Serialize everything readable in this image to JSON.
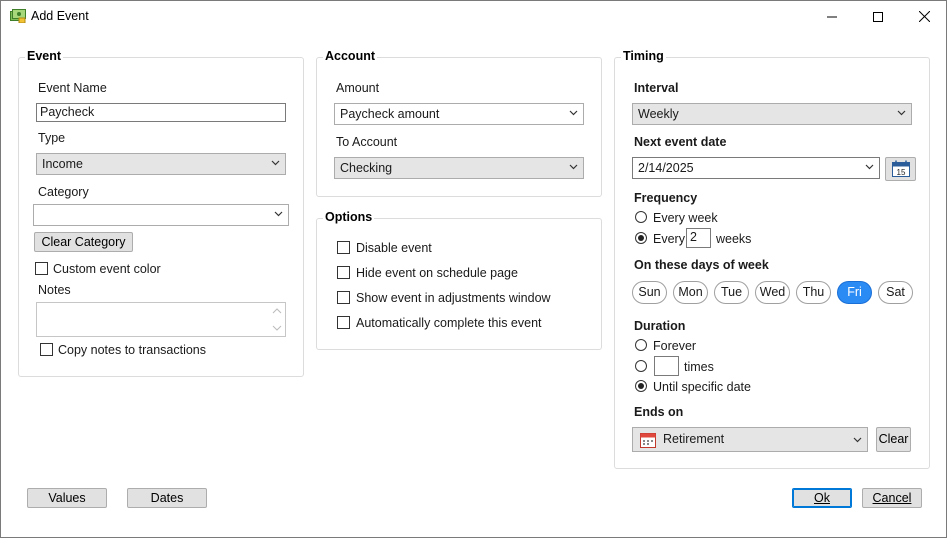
{
  "window": {
    "title": "Add Event"
  },
  "event": {
    "group_title": "Event",
    "name_label": "Event Name",
    "name_value": "Paycheck",
    "type_label": "Type",
    "type_value": "Income",
    "category_label": "Category",
    "category_value": "",
    "clear_category_label": "Clear Category",
    "custom_color_label": "Custom event color",
    "notes_label": "Notes",
    "notes_value": "",
    "copy_notes_label": "Copy notes to transactions"
  },
  "account": {
    "group_title": "Account",
    "amount_label": "Amount",
    "amount_value": "Paycheck amount",
    "to_account_label": "To Account",
    "to_account_value": "Checking"
  },
  "options": {
    "group_title": "Options",
    "items": [
      {
        "label": "Disable event",
        "checked": false
      },
      {
        "label": "Hide event on schedule page",
        "checked": false
      },
      {
        "label": "Show event in adjustments window",
        "checked": false
      },
      {
        "label": "Automatically complete this event",
        "checked": false
      }
    ]
  },
  "timing": {
    "group_title": "Timing",
    "interval_label": "Interval",
    "interval_value": "Weekly",
    "next_date_label": "Next event date",
    "next_date_value": "2/14/2025",
    "calendar_day": "15",
    "frequency_label": "Frequency",
    "every_week_label": "Every week",
    "every_label": "Every",
    "every_n_value": "2",
    "weeks_label": "weeks",
    "days_label": "On these days of week",
    "days": [
      {
        "label": "Sun",
        "selected": false
      },
      {
        "label": "Mon",
        "selected": false
      },
      {
        "label": "Tue",
        "selected": false
      },
      {
        "label": "Wed",
        "selected": false
      },
      {
        "label": "Thu",
        "selected": false
      },
      {
        "label": "Fri",
        "selected": true
      },
      {
        "label": "Sat",
        "selected": false
      }
    ],
    "duration_label": "Duration",
    "forever_label": "Forever",
    "times_value": "",
    "times_label": "times",
    "until_label": "Until specific date",
    "ends_on_label": "Ends on",
    "ends_on_value": "Retirement",
    "clear_label": "Clear"
  },
  "footer": {
    "values_label": "Values",
    "dates_label": "Dates",
    "ok_label": "Ok",
    "cancel_label": "Cancel"
  },
  "colors": {
    "selected_day": "#2b8bf5",
    "default_button_border": "#0078d7"
  }
}
